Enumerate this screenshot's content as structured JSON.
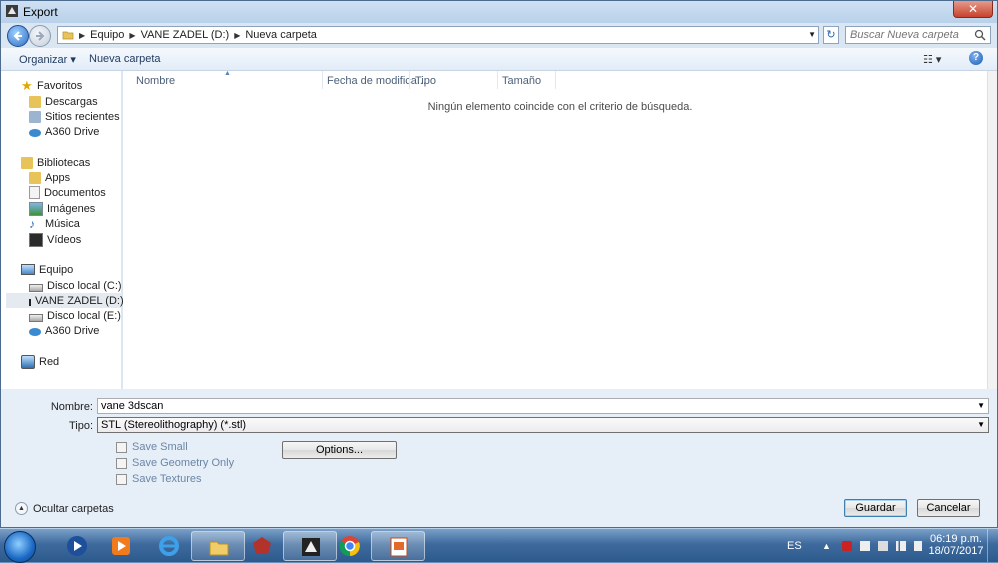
{
  "window": {
    "title": "Export",
    "close_label": "✕"
  },
  "address": {
    "crumbs": [
      "Equipo",
      "VANE ZADEL (D:)",
      "Nueva carpeta"
    ],
    "search_placeholder": "Buscar Nueva carpeta"
  },
  "toolbar": {
    "organize": "Organizar ▾",
    "new_folder": "Nueva carpeta",
    "help": "?"
  },
  "nav": {
    "groups": [
      {
        "label": "Favoritos",
        "items": [
          "Descargas",
          "Sitios recientes",
          "A360 Drive"
        ]
      },
      {
        "label": "Bibliotecas",
        "items": [
          "Apps",
          "Documentos",
          "Imágenes",
          "Música",
          "Vídeos"
        ]
      },
      {
        "label": "Equipo",
        "items": [
          "Disco local (C:)",
          "VANE ZADEL (D:)",
          "Disco local (E:)",
          "A360 Drive"
        ]
      },
      {
        "label": "Red",
        "items": []
      }
    ],
    "selected": "VANE ZADEL (D:)"
  },
  "columns": [
    "Nombre",
    "Fecha de modifica...",
    "Tipo",
    "Tamaño"
  ],
  "empty_message": "Ningún elemento coincide con el criterio de búsqueda.",
  "form": {
    "name_label": "Nombre:",
    "name_value": "vane 3dscan",
    "type_label": "Tipo:",
    "type_value": "STL (Stereolithography) (*.stl)",
    "options": [
      "Save Small",
      "Save Geometry Only",
      "Save Textures"
    ],
    "options_button": "Options...",
    "hide_folders": "Ocultar carpetas",
    "save_button": "Guardar",
    "cancel_button": "Cancelar"
  },
  "taskbar": {
    "language": "ES",
    "time": "06:19 p.m.",
    "date": "18/07/2017"
  },
  "colors": {
    "accent": "#2f6fc6",
    "window_bg": "#dbe6f3"
  }
}
